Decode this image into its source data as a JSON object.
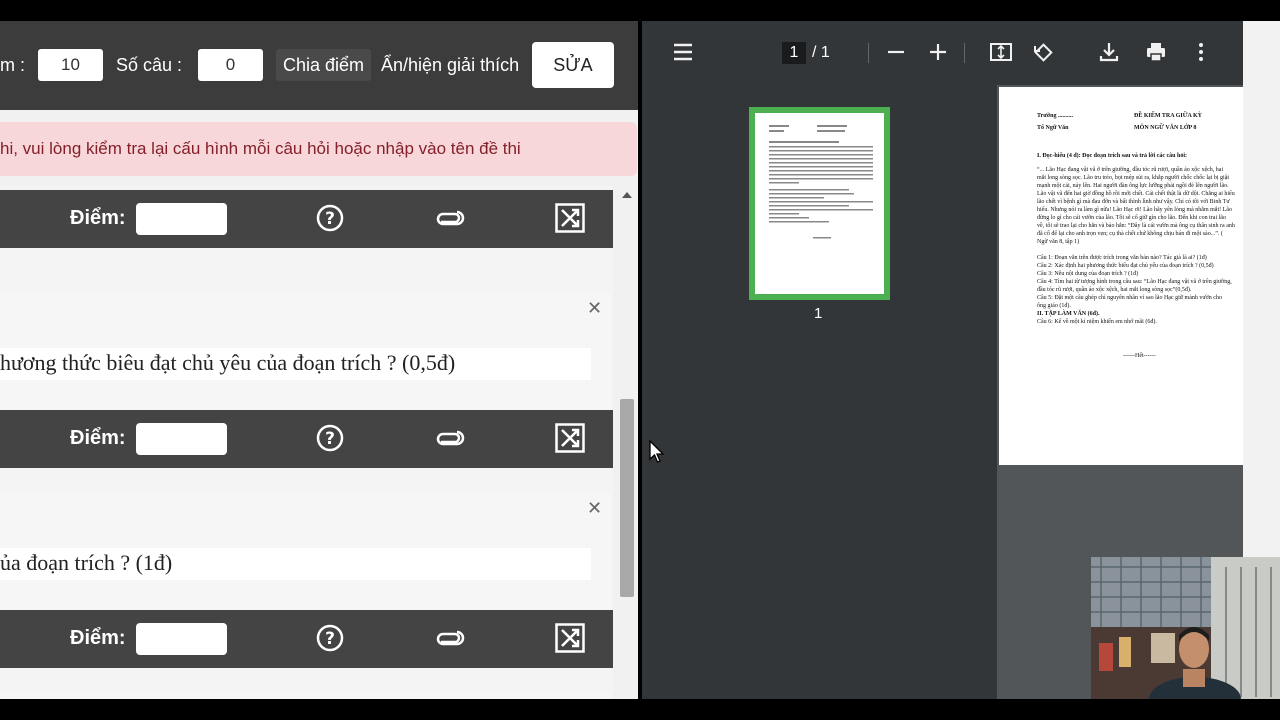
{
  "editor": {
    "score_label_partial": "m :",
    "score_value": "10",
    "question_count_label": "Số câu :",
    "question_count_value": "0",
    "divide_points_label": "Chia điểm",
    "toggle_explanation_label": "Ẩn/hiện giải thích",
    "edit_button_label": "SỬA",
    "alert_text": "hi, vui lòng kiểm tra lại cấu hình mỗi câu hỏi hoặc nhập vào tên đề thi",
    "score_field_label": "Điểm:",
    "questions": [
      {
        "text": "hương thức biêu đạt chủ yêu của đoạn trích ? (0,5đ)"
      },
      {
        "text": "ủa đoạn trích ? (1đ)"
      }
    ]
  },
  "pdf_viewer": {
    "current_page": "1",
    "total_pages": "/ 1",
    "thumbnail_label": "1",
    "page_content": {
      "school": "Trường ..........",
      "group": "Tổ Ngữ Văn",
      "exam_title": "ĐỀ KIỂM TRA GIỮA KỲ",
      "subject": "MÔN NGỮ VĂN LỚP 8",
      "section1": "I. Đọc-hiểu (4 đ): Đọc đoạn trích sau và trả lời các câu hỏi:",
      "passage": [
        "“... Lão Hạc đang vật vã ở trên giường, đầu tóc rũ rượi, quần áo xộc xệch, hai",
        "mắt long sòng sọc. Lão tru tréo, bọt mép sùi ra, khắp người chốc chốc lại bị giật",
        "mạnh một cái, nảy lên. Hai người đàn ông lực lưỡng phải ngồi đè lên người lão.",
        "Lão vật vã đến hai giờ đồng hồ rồi mới chết. Cái chết thật là dữ dội. Chẳng ai hiểu",
        "lão chết vì bệnh gì mà đau đớn và bất thình lình như vậy. Chỉ có tôi với Binh Tư",
        "hiểu. Nhưng nói ra làm gì nữa! Lão Hạc ơi! Lão hãy yên lòng mà nhắm mắt! Lão",
        "đừng lo gì cho cái vườn của lão. Tôi sẽ cố giữ gìn cho lão. Đến khi con trai lão",
        "về, tôi sẽ trao lại cho hắn và bảo hắn: “Đây là cái vườn mà ông cụ thân sinh ra anh",
        "đã cố để lại cho anh trọn vẹn; cụ thà chết chứ không chịu bán đi một sào...”. (",
        "Ngữ văn 8, tập 1)"
      ],
      "questions": [
        "Câu 1: Đoạn văn trên được trích trong văn bản nào? Tác giả là ai? (1đ)",
        "Câu 2: Xác định hai phương thức biểu đạt chủ yếu của đoạn trích ? (0,5đ)",
        "Câu 3: Nêu nội dung của đoạn trích ? (1đ)",
        "Câu 4: Tìm hai từ tượng hình trong câu sau: “Lão Hạc đang vật vã ở trên giường,",
        "đầu tóc rũ rượi, quần áo xộc xệch, hai mắt long sòng sọc”(0,5đ).",
        "Câu 5: Đặt một câu ghép chỉ nguyên nhân vì sao lão Hạc giữ mảnh vườn cho",
        "ông giáo (1đ).",
        "II. TẬP LÀM VĂN (6đ).",
        "Câu 6: Kể về một kỉ niệm khiến em nhớ mãi (6đ)."
      ],
      "footer": "------Hết------"
    }
  }
}
